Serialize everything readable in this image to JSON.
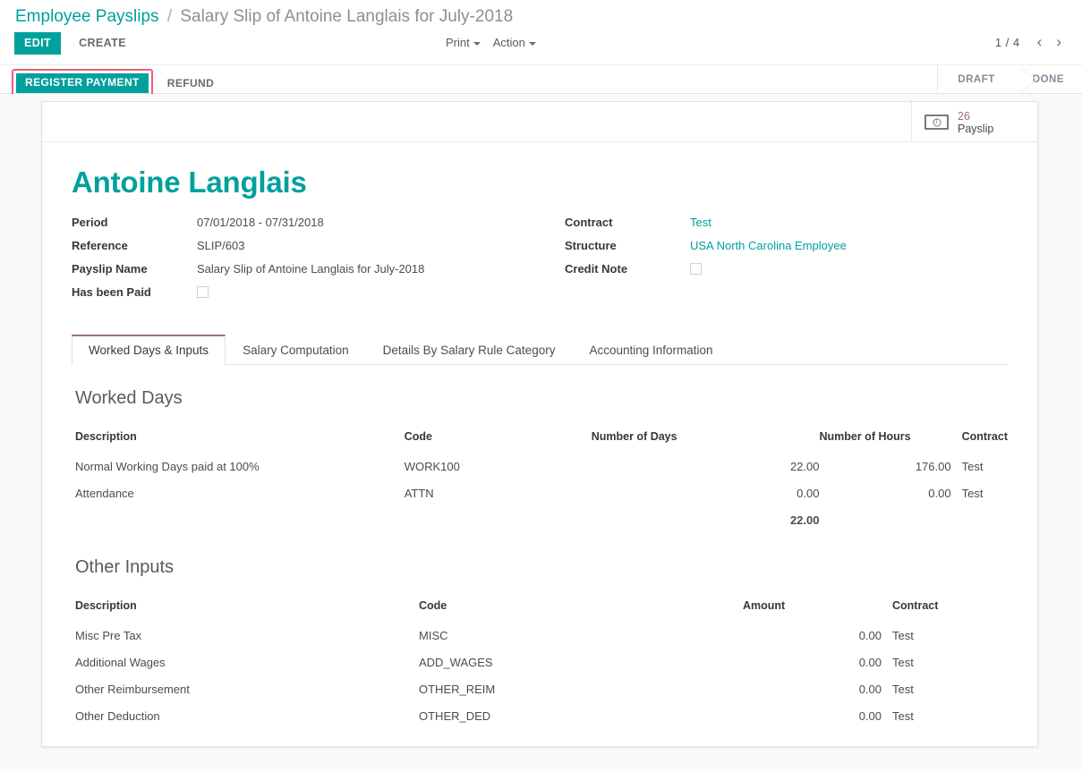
{
  "breadcrumb": {
    "root": "Employee Payslips",
    "separator": "/",
    "current": "Salary Slip of Antoine Langlais for July-2018"
  },
  "controls": {
    "edit_label": "EDIT",
    "create_label": "CREATE",
    "print_label": "Print",
    "action_label": "Action",
    "pager_count": "1 / 4",
    "prev_label": "‹",
    "next_label": "›"
  },
  "workflow": {
    "register_payment_label": "REGISTER PAYMENT",
    "refund_label": "REFUND",
    "highlight_color": "#ef5c7f",
    "accent_color": "#00a09d",
    "statuses": [
      {
        "label": "DRAFT",
        "active": false
      },
      {
        "label": "DONE",
        "active": false
      }
    ]
  },
  "stat_button": {
    "icon": "money-bill-icon",
    "count": "26",
    "label": "Payslip"
  },
  "record": {
    "title": "Antoine Langlais",
    "left_fields": [
      {
        "label": "Period",
        "value": "07/01/2018 - 07/31/2018",
        "type": "text"
      },
      {
        "label": "Reference",
        "value": "SLIP/603",
        "type": "text"
      },
      {
        "label": "Payslip Name",
        "value": "Salary Slip of Antoine Langlais for July-2018",
        "type": "text"
      },
      {
        "label": "Has been Paid",
        "value": "",
        "type": "checkbox",
        "checked": false
      }
    ],
    "right_fields": [
      {
        "label": "Contract",
        "value": "Test",
        "type": "link"
      },
      {
        "label": "Structure",
        "value": "USA North Carolina Employee",
        "type": "link"
      },
      {
        "label": "Credit Note",
        "value": "",
        "type": "checkbox",
        "checked": false
      }
    ]
  },
  "tabs": [
    {
      "label": "Worked Days & Inputs",
      "active": true
    },
    {
      "label": "Salary Computation",
      "active": false
    },
    {
      "label": "Details By Salary Rule Category",
      "active": false
    },
    {
      "label": "Accounting Information",
      "active": false
    }
  ],
  "worked_days": {
    "title": "Worked Days",
    "headers": {
      "description": "Description",
      "code": "Code",
      "number_of_days": "Number of Days",
      "number_of_hours": "Number of Hours",
      "contract": "Contract"
    },
    "rows": [
      {
        "description": "Normal Working Days paid at 100%",
        "code": "WORK100",
        "number_of_days": "22.00",
        "number_of_hours": "176.00",
        "contract": "Test"
      },
      {
        "description": "Attendance",
        "code": "ATTN",
        "number_of_days": "0.00",
        "number_of_hours": "0.00",
        "contract": "Test"
      }
    ],
    "total_days": "22.00"
  },
  "other_inputs": {
    "title": "Other Inputs",
    "headers": {
      "description": "Description",
      "code": "Code",
      "amount": "Amount",
      "contract": "Contract"
    },
    "rows": [
      {
        "description": "Misc Pre Tax",
        "code": "MISC",
        "amount": "0.00",
        "contract": "Test"
      },
      {
        "description": "Additional Wages",
        "code": "ADD_WAGES",
        "amount": "0.00",
        "contract": "Test"
      },
      {
        "description": "Other Reimbursement",
        "code": "OTHER_REIM",
        "amount": "0.00",
        "contract": "Test"
      },
      {
        "description": "Other Deduction",
        "code": "OTHER_DED",
        "amount": "0.00",
        "contract": "Test"
      }
    ]
  }
}
